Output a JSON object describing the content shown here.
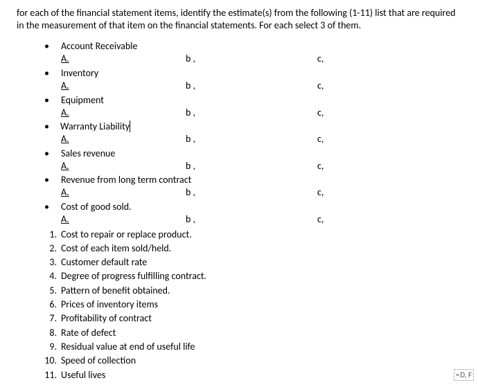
{
  "instructions": "for each of the financial statement items, identify the estimate(s) from the following (1-11) list that are required in the measurement of that item on the financial statements. For each select 3 of them.",
  "sub": {
    "a": "A.",
    "b": "b ,",
    "c": "c,"
  },
  "items": [
    {
      "name": "Account Receivable",
      "cursor": false
    },
    {
      "name": "Inventory",
      "cursor": false
    },
    {
      "name": "Equipment",
      "cursor": false
    },
    {
      "name": "Warranty Liability",
      "cursor": true
    },
    {
      "name": "Sales revenue",
      "cursor": false
    },
    {
      "name": "Revenue from long term contract",
      "cursor": false
    },
    {
      "name": "Cost of good sold.",
      "cursor": false
    }
  ],
  "estimates": [
    "Cost to repair or replace product.",
    "Cost of each item sold/held.",
    "Customer default rate",
    "Degree of progress fulfilling contract.",
    "Pattern of benefit obtained.",
    "Prices of inventory items",
    "Profitability of contract",
    "Rate of defect",
    "Residual value at end of useful life",
    "Speed of collection",
    "Useful lives"
  ],
  "footer_icon": "D, F"
}
